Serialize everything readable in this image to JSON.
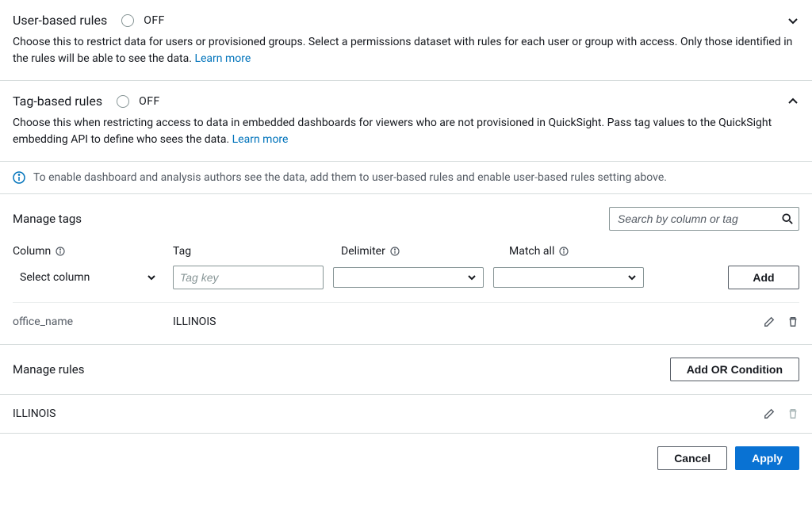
{
  "sections": {
    "userBased": {
      "title": "User-based rules",
      "toggleState": "OFF",
      "desc": "Choose this to restrict data for users or provisioned groups. Select a permissions dataset with rules for each user or group with access. Only those identified in the rules will be able to see the data.",
      "learnMore": "Learn more"
    },
    "tagBased": {
      "title": "Tag-based rules",
      "toggleState": "OFF",
      "desc": "Choose this when restricting access to data in embedded dashboards for viewers who are not provisioned in QuickSight. Pass tag values to the QuickSight embedding API to define who sees the data.",
      "learnMore": "Learn more"
    }
  },
  "infoBanner": "To enable dashboard and analysis authors see the data, add them to user-based rules and enable user-based rules setting above.",
  "manageTags": {
    "title": "Manage tags",
    "searchPlaceholder": "Search by column or tag",
    "headers": {
      "column": "Column",
      "tag": "Tag",
      "delimiter": "Delimiter",
      "matchAll": "Match all"
    },
    "inputRow": {
      "selectColumn": "Select column",
      "tagKeyPlaceholder": "Tag key",
      "addLabel": "Add"
    },
    "dataRow": {
      "column": "office_name",
      "tag": "ILLINOIS"
    }
  },
  "manageRules": {
    "title": "Manage rules",
    "addOrLabel": "Add OR Condition",
    "rule": "ILLINOIS"
  },
  "footer": {
    "cancel": "Cancel",
    "apply": "Apply"
  }
}
